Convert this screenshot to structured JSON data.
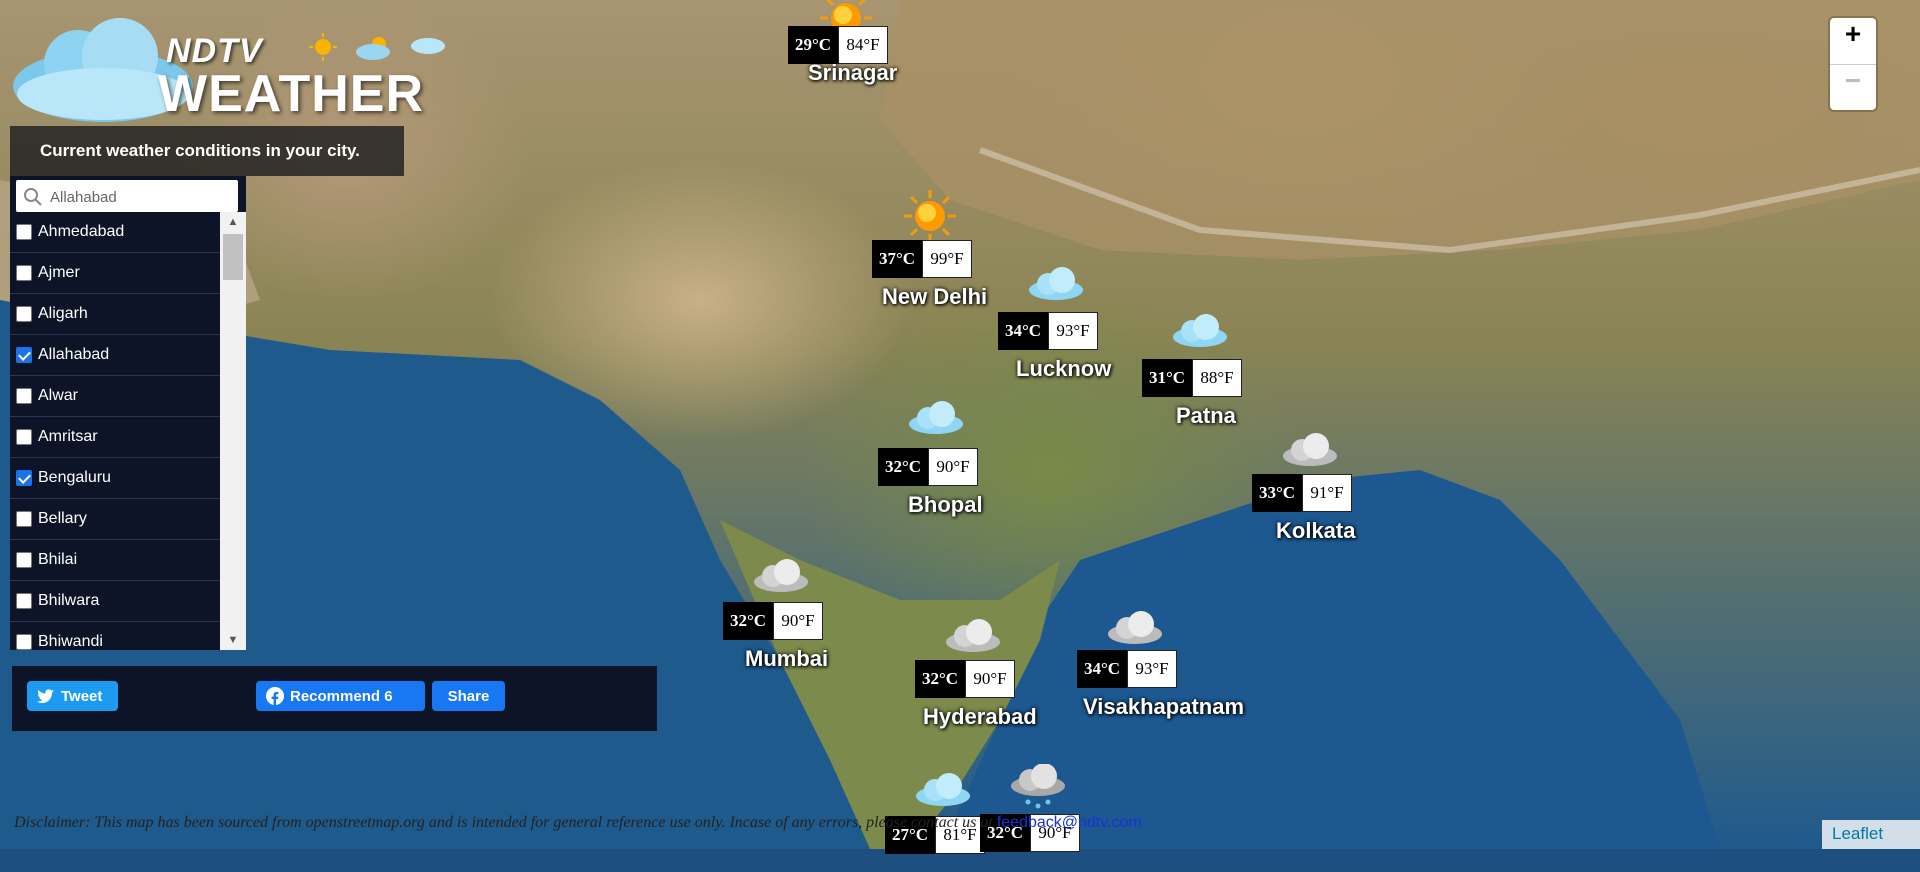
{
  "logo": {
    "brand": "NDTV",
    "title": "WEATHER"
  },
  "panel": {
    "tagline": "Current weather conditions in your city.",
    "search_value": "Allahabad",
    "cities": [
      {
        "name": "Ahmedabad",
        "checked": false
      },
      {
        "name": "Ajmer",
        "checked": false
      },
      {
        "name": "Aligarh",
        "checked": false
      },
      {
        "name": "Allahabad",
        "checked": true
      },
      {
        "name": "Alwar",
        "checked": false
      },
      {
        "name": "Amritsar",
        "checked": false
      },
      {
        "name": "Bengaluru",
        "checked": true
      },
      {
        "name": "Bellary",
        "checked": false
      },
      {
        "name": "Bhilai",
        "checked": false
      },
      {
        "name": "Bhilwara",
        "checked": false
      },
      {
        "name": "Bhiwandi",
        "checked": false
      }
    ]
  },
  "share": {
    "tweet": "Tweet",
    "recommend": "Recommend 6",
    "share": "Share"
  },
  "zoom": {
    "in": "+",
    "out": "−"
  },
  "markers": [
    {
      "city": "Srinagar",
      "c": "29°C",
      "f": "84°F",
      "icon": "sun-icon"
    },
    {
      "city": "New Delhi",
      "c": "37°C",
      "f": "99°F",
      "icon": "sun-icon"
    },
    {
      "city": "Lucknow",
      "c": "34°C",
      "f": "93°F",
      "icon": "cloud-icon"
    },
    {
      "city": "Patna",
      "c": "31°C",
      "f": "88°F",
      "icon": "cloud-icon"
    },
    {
      "city": "Bhopal",
      "c": "32°C",
      "f": "90°F",
      "icon": "cloud-icon"
    },
    {
      "city": "Kolkata",
      "c": "33°C",
      "f": "91°F",
      "icon": "grey-cloud-icon"
    },
    {
      "city": "Mumbai",
      "c": "32°C",
      "f": "90°F",
      "icon": "grey-cloud-icon"
    },
    {
      "city": "Hyderabad",
      "c": "32°C",
      "f": "90°F",
      "icon": "grey-cloud-icon"
    },
    {
      "city": "Visakhapatnam",
      "c": "34°C",
      "f": "93°F",
      "icon": "grey-cloud-icon"
    },
    {
      "city": "",
      "c": "27°C",
      "f": "81°F",
      "icon": "cloud-icon"
    },
    {
      "city": "",
      "c": "32°C",
      "f": "90°F",
      "icon": "rain-cloud-icon"
    }
  ],
  "disclaimer": {
    "text": "Disclaimer: This map has been sourced from openstreetmap.org and is intended for general reference use only. Incase of any errors, please contact us at",
    "email": "feedback@ndtv.com"
  },
  "attribution": "Leaflet"
}
